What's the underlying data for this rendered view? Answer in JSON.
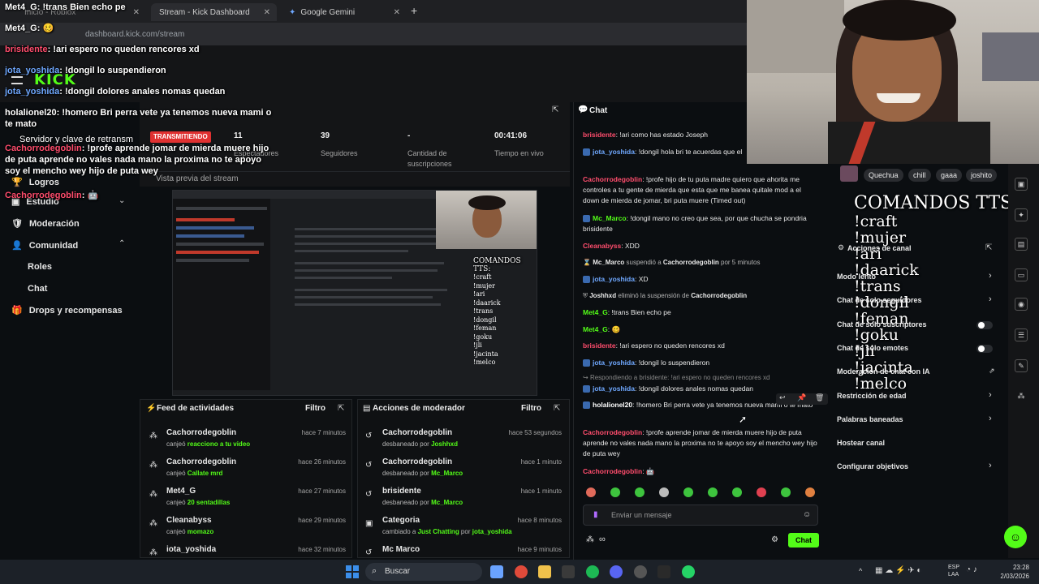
{
  "browser": {
    "tabs": [
      {
        "label": "Inicio - Roblox"
      },
      {
        "label": "Stream - Kick Dashboard"
      },
      {
        "label": "Google Gemini"
      }
    ],
    "new_tab": "+",
    "address": "dashboard.kick.com/stream"
  },
  "overlay_chat": [
    {
      "user": "Met4_G",
      "sep": ": ",
      "text": "!trans Bien echo pe",
      "color": "#ffffff"
    },
    {
      "user": "Met4_G",
      "sep": ": ",
      "text": "🥴",
      "color": "#ffffff"
    },
    {
      "user": "brisidente",
      "sep": ": ",
      "text": "!ari espero no queden rencores xd",
      "color": "#ff4d6d"
    },
    {
      "user": "jota_yoshida",
      "sep": ": ",
      "text": "!dongil lo suspendieron",
      "color": "#6fa8ff"
    },
    {
      "user": "jota_yoshida",
      "sep": ": ",
      "text": "!dongil dolores anales nomas quedan",
      "color": "#6fa8ff"
    },
    {
      "user": "holalionel20",
      "sep": ": ",
      "text": "!homero Bri perra vete ya tenemos nueva mami o te mato",
      "color": "#ffffff"
    },
    {
      "user": "Cachorrodegoblin",
      "sep": ": ",
      "text": "!profe aprende jomar de mierda muere hijo de puta aprende no vales nada mano la proxima no te apoyo soy el mencho wey hijo de puta wey",
      "color": "#ff4d6d"
    },
    {
      "user": "Cachorrodegoblin",
      "sep": ": ",
      "text": "🤖",
      "color": "#ff4d6d"
    }
  ],
  "behind_overlay": {
    "server_key": "Servidor y clave de retransm",
    "live_badge": "TRANSMITIENDO",
    "viewers_value": "11",
    "viewers_label": "Espectadores"
  },
  "sidebar": {
    "items": [
      {
        "label": "Logros"
      },
      {
        "label": "Estudio"
      },
      {
        "label": "Moderación"
      },
      {
        "label": "Comunidad"
      }
    ],
    "sub_items": [
      {
        "label": "Roles"
      },
      {
        "label": "Chat"
      }
    ],
    "drops": "Drops y recompensas"
  },
  "stats": [
    {
      "value": "39",
      "label": "Seguidores"
    },
    {
      "value": "-",
      "label": "Cantidad de suscripciones"
    },
    {
      "value": "00:41:06",
      "label": "Tiempo en vivo"
    }
  ],
  "preview_label": "Vista previa del stream",
  "preview_commands": {
    "title": "COMANDOS TTS:",
    "items": [
      "!craft",
      "!mujer",
      "!ari",
      "!daarick",
      "!trans",
      "!dongil",
      "!feman",
      "!goku",
      "!jli",
      "!jacinta",
      "!melco"
    ]
  },
  "activity_feed": {
    "title": "Feed de actividades",
    "filter": "Filtro",
    "items": [
      {
        "name": "Cachorrodegoblin",
        "prefix": "canjeó ",
        "action": "reacciono a tu video",
        "time": "hace 7 minutos"
      },
      {
        "name": "Cachorrodegoblin",
        "prefix": "canjeó ",
        "action": "Callate mrd",
        "time": "hace 26 minutos"
      },
      {
        "name": "Met4_G",
        "prefix": "canjeó ",
        "action": "20 sentadillas",
        "time": "hace 27 minutos"
      },
      {
        "name": "Cleanabyss",
        "prefix": "canjeó ",
        "action": "momazo",
        "time": "hace 29 minutos"
      },
      {
        "name": "iota_yoshida",
        "prefix": "",
        "action": "",
        "time": "hace 32 minutos"
      }
    ]
  },
  "mod_actions": {
    "title": "Acciones de moderador",
    "filter": "Filtro",
    "items": [
      {
        "name": "Cachorrodegoblin",
        "prefix": "desbaneado por ",
        "actor": "Joshhxd",
        "time": "hace 53 segundos"
      },
      {
        "name": "Cachorrodegoblin",
        "prefix": "desbaneado por ",
        "actor": "Mc_Marco",
        "time": "hace 1 minuto"
      },
      {
        "name": "brisidente",
        "prefix": "desbaneado por ",
        "actor": "Mc_Marco",
        "time": "hace 1 minuto"
      },
      {
        "name": "Categoria",
        "prefix": "cambiado a ",
        "actor": "Just Chatting",
        "suffix": " por ",
        "actor2": "jota_yoshida",
        "time": "hace 8 minutos"
      },
      {
        "name": "Mc Marco",
        "prefix": "",
        "actor": "",
        "time": "hace 9 minutos"
      }
    ]
  },
  "chat": {
    "title": "Chat",
    "messages": [
      {
        "user": "brisidente",
        "color": "#ff4d6d",
        "text": ": !ari como has estado Joseph",
        "badge": false
      },
      {
        "user": "jota_yoshida",
        "color": "#6fa8ff",
        "text": ": !dongil hola bri te acuerdas que el",
        "badge": true
      },
      {
        "user": "Cachorrodegoblin",
        "color": "#ff4d6d",
        "text": ": !profe hijo de tu puta madre quiero que ahorita me controles a tu gente de mierda que esta que me banea quitale mod a el down de mierda de jomar, bri puta muere (Timed out)",
        "badge": false
      },
      {
        "user": "Mc_Marco",
        "color": "#53fc18",
        "text": ": !dongil mano no creo que sea, por que chucha se pondria brisidente",
        "badge": true
      },
      {
        "user": "Cleanabyss",
        "color": "#ff4d6d",
        "text": ": XDD",
        "badge": false
      }
    ],
    "sys1": {
      "actor": "Mc_Marco",
      "verb": " suspendió a ",
      "target": "Cachorrodegoblin",
      "tail": " por 5 minutos"
    },
    "msg_xd": {
      "user": "jota_yoshida",
      "text": ": XD"
    },
    "sys2": {
      "actor": "Joshhxd",
      "verb": " eliminó la suspensión de ",
      "target": "Cachorrodegoblin"
    },
    "messages2": [
      {
        "user": "Met4_G",
        "color": "#53fc18",
        "text": ": !trans Bien echo pe",
        "badge": false
      },
      {
        "user": "Met4_G",
        "color": "#53fc18",
        "text": ": 🥴",
        "badge": false
      },
      {
        "user": "brisidente",
        "color": "#ff4d6d",
        "text": ": !ari espero no queden rencores xd",
        "badge": false
      },
      {
        "user": "jota_yoshida",
        "color": "#6fa8ff",
        "text": ": !dongil lo suspendieron",
        "badge": true
      }
    ],
    "reply_note": "Respondiendo a brisidente: !ari espero no queden rencores xd",
    "messages3": [
      {
        "user": "jota_yoshida",
        "color": "#6fa8ff",
        "text": ": !dongil dolores anales nomas quedan",
        "badge": true
      },
      {
        "user": "holalionel20",
        "color": "#ffffff",
        "text": ": !homero Bri perra vete ya tenemos nueva mami o te mato",
        "badge": true
      },
      {
        "user": "Cachorrodegoblin",
        "color": "#ff4d6d",
        "text": ": !profe aprende jomar de mierda muere hijo de puta aprende no vales nada mano la proxima no te apoyo soy el mencho wey hijo de puta wey",
        "badge": false
      },
      {
        "user": "Cachorrodegoblin",
        "color": "#ff4d6d",
        "text": ": 🤖",
        "badge": false
      }
    ],
    "input_placeholder": "Enviar un mensaje",
    "send_label": "Chat",
    "infinity": "∞"
  },
  "right_panel": {
    "tags": [
      "Quechua",
      "chill",
      "gaaa",
      "joshito"
    ],
    "header": "Acciones de canal",
    "menu": [
      {
        "label": "Modo lento",
        "control": "arrow"
      },
      {
        "label": "Chat de solo seguidores",
        "control": "arrow"
      },
      {
        "label": "Chat de solo suscriptores",
        "control": "toggle"
      },
      {
        "label": "Chat de solo emotes",
        "control": "toggle"
      },
      {
        "label": "Moderación de chat con IA",
        "control": "link"
      },
      {
        "label": "Restricción de edad",
        "control": "arrow"
      },
      {
        "label": "Palabras baneadas",
        "control": "arrow"
      },
      {
        "label": "Hostear canal",
        "control": "none"
      },
      {
        "label": "Configurar objetivos",
        "control": "arrow"
      }
    ],
    "commands_title": "COMANDOS TTS:",
    "commands": [
      "!craft",
      "!mujer",
      "!ari",
      "!daarick",
      "!trans",
      "!dongil",
      "!feman",
      "!goku",
      "!jli",
      "!jacinta",
      "!melco"
    ]
  },
  "taskbar": {
    "search": "Buscar",
    "lang": "ESP",
    "lang2": "LAA",
    "time": "23:28",
    "date": "2/03/2026"
  },
  "colors": {
    "kick_green": "#53fc18",
    "user_red": "#ff4d6d",
    "user_blue": "#6fa8ff"
  }
}
